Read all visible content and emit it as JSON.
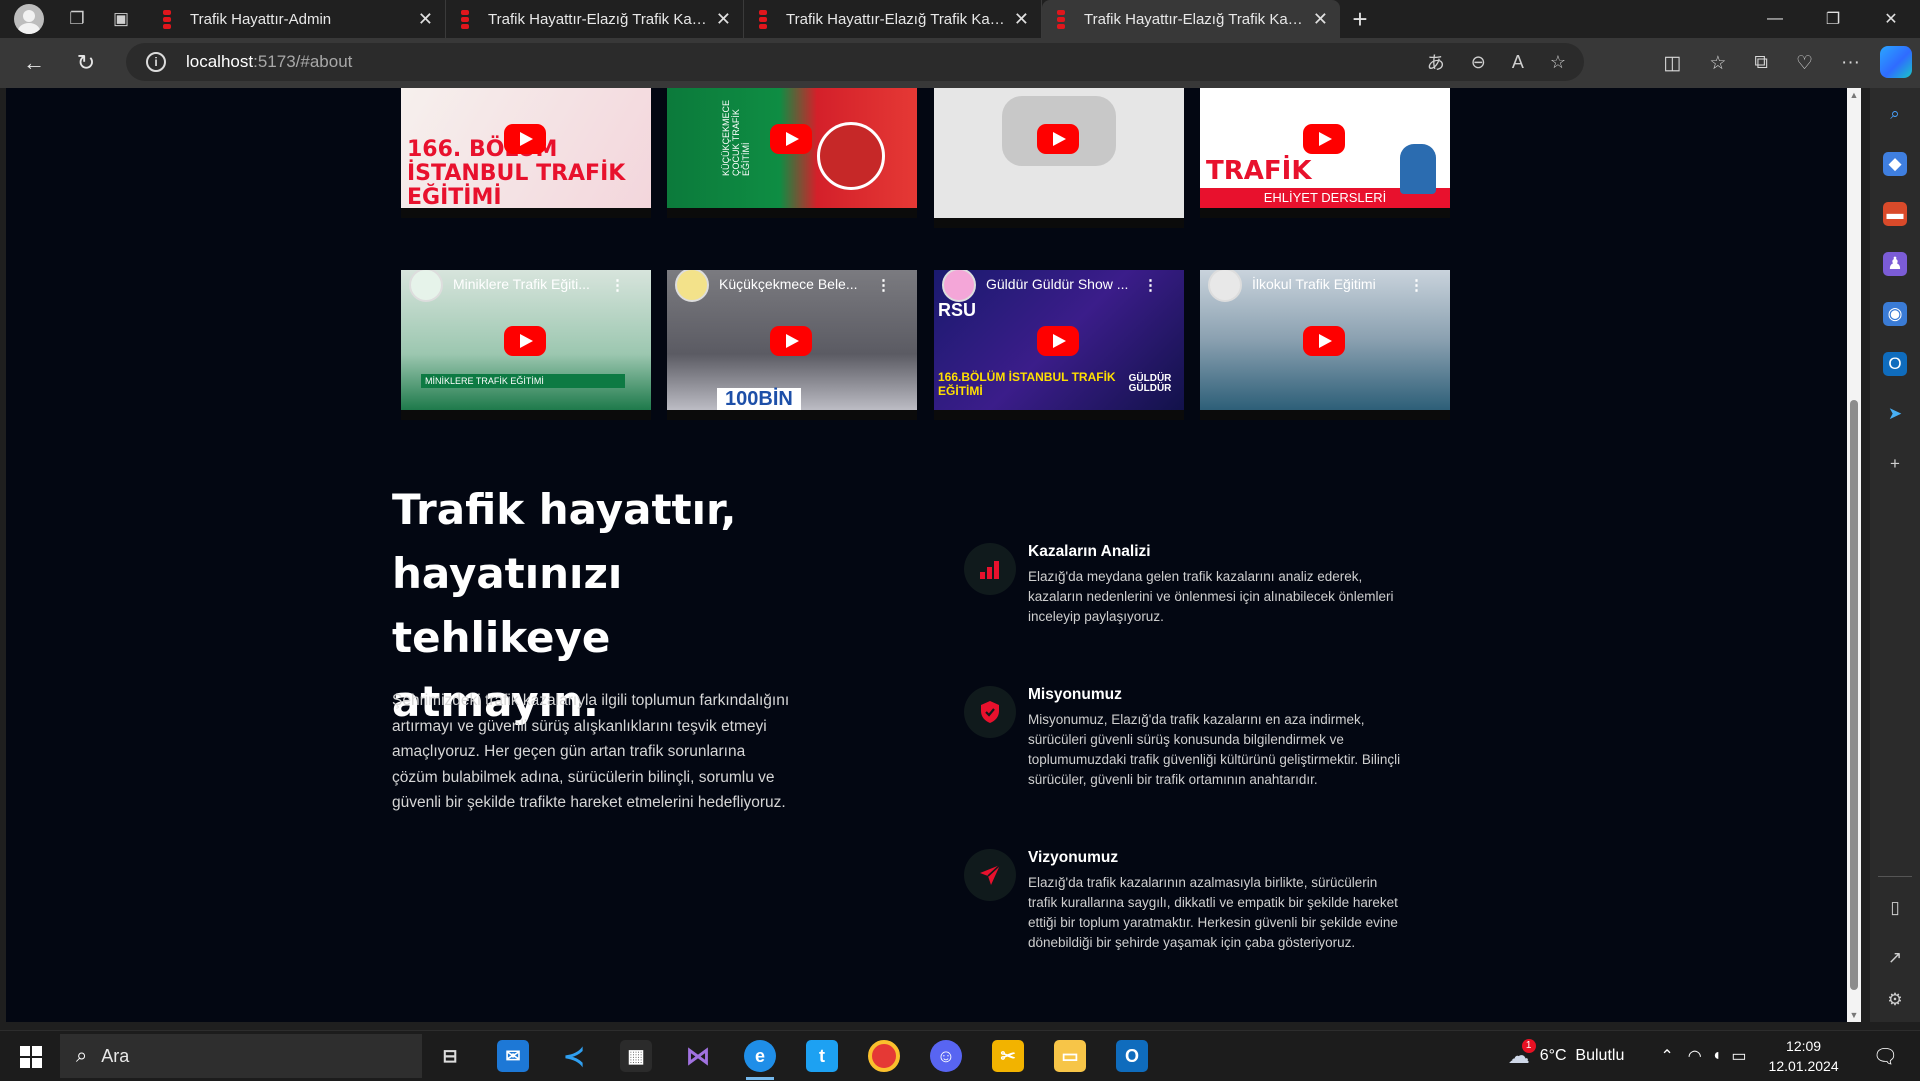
{
  "browser": {
    "tabs": [
      {
        "title": "Trafik Hayattır-Admin",
        "active": false
      },
      {
        "title": "Trafik Hayattır-Elazığ Trafik Kazaları",
        "active": false
      },
      {
        "title": "Trafik Hayattır-Elazığ Trafik Kazaları",
        "active": false
      },
      {
        "title": "Trafik Hayattır-Elazığ Trafik Kazaları",
        "active": true
      }
    ],
    "url_host": "localhost",
    "url_rest": ":5173/#about"
  },
  "videos_top": [
    {
      "overlay_text": "166. BÖLÜM İSTANBUL TRAFİK EĞİTİMİ"
    },
    {
      "overlay_text": "KÜÇÜKÇEKMECE ÇOCUK TRAFİK EĞİTİMİ"
    },
    {
      "overlay_text": ""
    },
    {
      "overlay_text": "TRAFİK LEVHALARI",
      "sub_text": "EHLİYET DERSLERİ"
    }
  ],
  "videos_bottom": [
    {
      "title": "Miniklere Trafik Eğiti...",
      "caption": "MİNİKLERE TRAFİK EĞİTİMİ"
    },
    {
      "title": "Küçükçekmece Bele...",
      "caption": "100BİN"
    },
    {
      "title": "Güldür Güldür Show ...",
      "caption": "166.BÖLÜM İSTANBUL TRAFİK EĞİTİMİ",
      "badge": "RSU",
      "logo_text": "GÜLDÜR GÜLDÜR"
    },
    {
      "title": "İlkokul Trafik Eğitimi",
      "caption": ""
    }
  ],
  "about": {
    "heading": "Trafik hayattır, hayatınızı tehlikeye atmayın.",
    "lead": "Şehrimizdeki trafik kazalarıyla ilgili toplumun farkındalığını artırmayı ve güvenli sürüş alışkanlıklarını teşvik etmeyi amaçlıyoruz. Her geçen gün artan trafik sorunlarına çözüm bulabilmek adına, sürücülerin bilinçli, sorumlu ve güvenli bir şekilde trafikte hareket etmelerini hedefliyoruz.",
    "features": [
      {
        "title": "Kazaların Analizi",
        "text": "Elazığ'da meydana gelen trafik kazalarını analiz ederek, kazaların nedenlerini ve önlenmesi için alınabilecek önlemleri inceleyip paylaşıyoruz.",
        "icon": "bar-chart-icon"
      },
      {
        "title": "Misyonumuz",
        "text": "Misyonumuz, Elazığ'da trafik kazalarını en aza indirmek, sürücüleri güvenli sürüş konusunda bilgilendirmek ve toplumumuzdaki trafik güvenliği kültürünü geliştirmektir. Bilinçli sürücüler, güvenli bir trafik ortamının anahtarıdır.",
        "icon": "shield-check-icon"
      },
      {
        "title": "Vizyonumuz",
        "text": "Elazığ'da trafik kazalarının azalmasıyla birlikte, sürücülerin trafik kurallarına saygılı, dikkatli ve empatik bir şekilde hareket ettiği bir toplum yaratmaktır. Herkesin güvenli bir şekilde evine dönebildiği bir şehirde yaşamak için çaba gösteriyoruz.",
        "icon": "paper-plane-icon"
      }
    ],
    "accent": "#e8112d"
  },
  "taskbar": {
    "search_placeholder": "Ara",
    "weather": "6°C  Bulutlu",
    "weather_badge": "1",
    "time": "12:09",
    "date": "12.01.2024"
  }
}
